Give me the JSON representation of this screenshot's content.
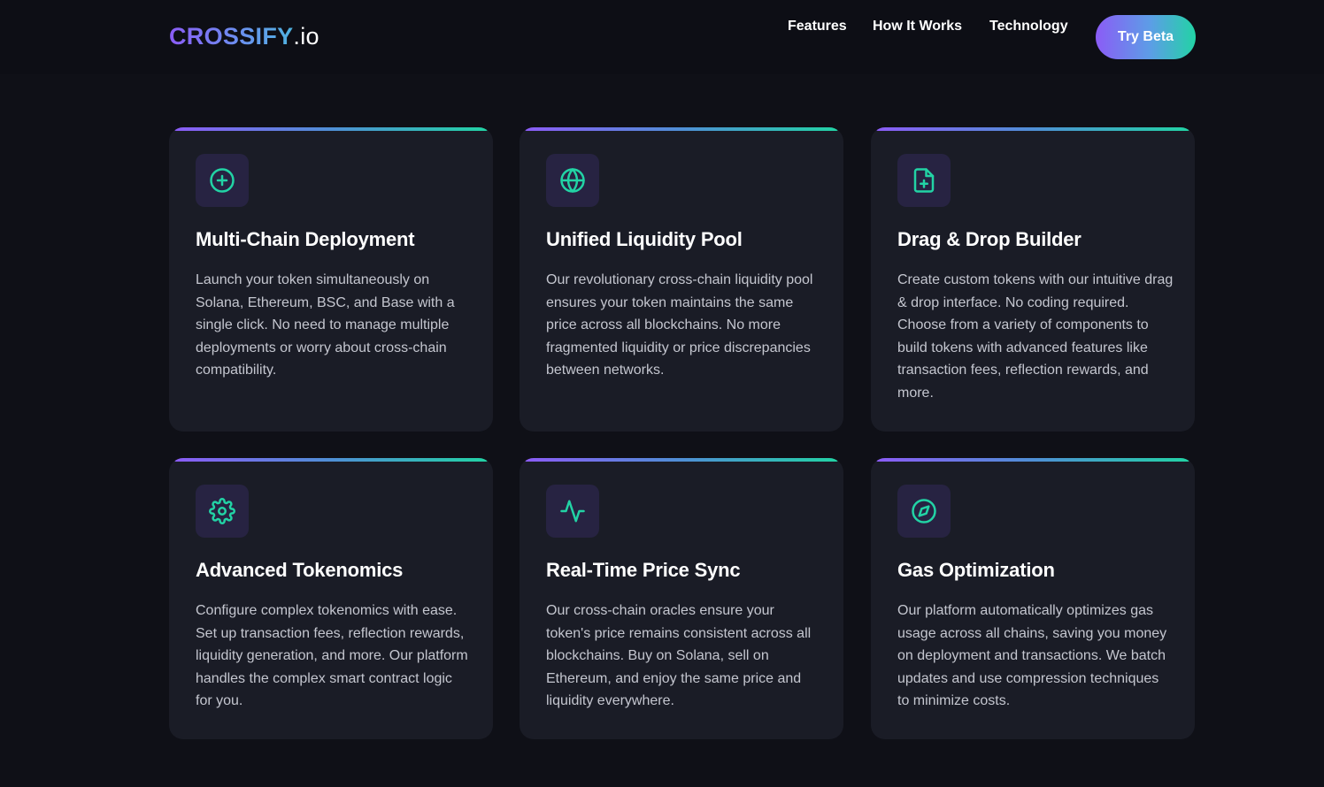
{
  "header": {
    "logo_brand": "CROSSIFY",
    "logo_tld": ".io",
    "nav": [
      "Features",
      "How It Works",
      "Technology"
    ],
    "cta_label": "Try Beta"
  },
  "colors": {
    "background": "#0f1017",
    "card": "#1a1c26",
    "icon_bg": "#272342",
    "accent_purple": "#8b5cf6",
    "accent_green": "#22d3a5"
  },
  "features": [
    {
      "icon": "plus-circle-icon",
      "title": "Multi-Chain Deployment",
      "description": "Launch your token simultaneously on Solana, Ethereum, BSC, and Base with a single click. No need to manage multiple deployments or worry about cross-chain compatibility."
    },
    {
      "icon": "globe-icon",
      "title": "Unified Liquidity Pool",
      "description": "Our revolutionary cross-chain liquidity pool ensures your token maintains the same price across all blockchains. No more fragmented liquidity or price discrepancies between networks."
    },
    {
      "icon": "file-plus-icon",
      "title": "Drag & Drop Builder",
      "description": "Create custom tokens with our intuitive drag & drop interface. No coding required. Choose from a variety of components to build tokens with advanced features like transaction fees, reflection rewards, and more."
    },
    {
      "icon": "gear-icon",
      "title": "Advanced Tokenomics",
      "description": "Configure complex tokenomics with ease. Set up transaction fees, reflection rewards, liquidity generation, and more. Our platform handles the complex smart contract logic for you."
    },
    {
      "icon": "activity-icon",
      "title": "Real-Time Price Sync",
      "description": "Our cross-chain oracles ensure your token's price remains consistent across all blockchains. Buy on Solana, sell on Ethereum, and enjoy the same price and liquidity everywhere."
    },
    {
      "icon": "compass-icon",
      "title": "Gas Optimization",
      "description": "Our platform automatically optimizes gas usage across all chains, saving you money on deployment and transactions. We batch updates and use compression techniques to minimize costs."
    }
  ]
}
